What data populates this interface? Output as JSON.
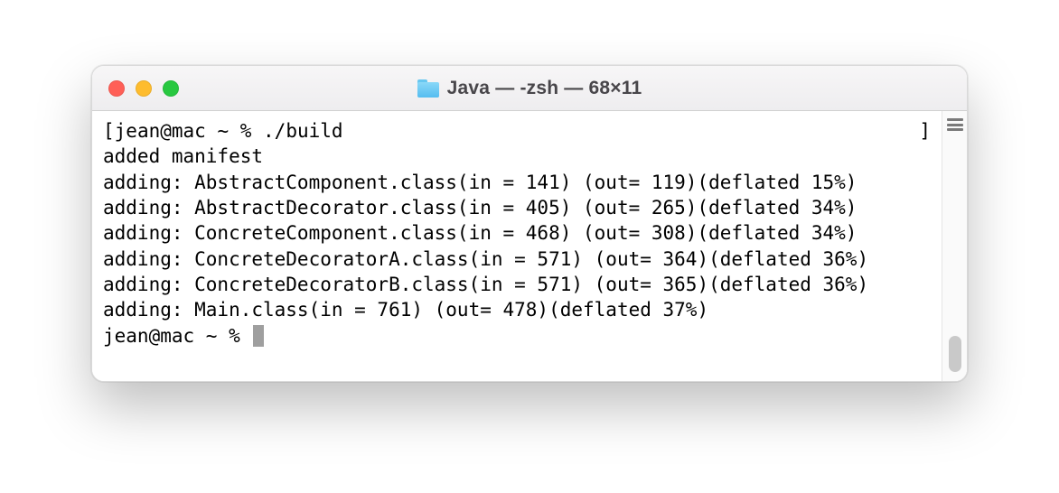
{
  "window": {
    "title": "Java — -zsh — 68×11",
    "folder_icon": "folder-icon"
  },
  "traffic": {
    "close": "close",
    "minimize": "minimize",
    "zoom": "zoom"
  },
  "terminal": {
    "prompt1_open": "[",
    "prompt1_user": "jean@mac ~ % ",
    "command1": "./build",
    "prompt1_close": "]",
    "lines": [
      "added manifest",
      "adding: AbstractComponent.class(in = 141) (out= 119)(deflated 15%)",
      "adding: AbstractDecorator.class(in = 405) (out= 265)(deflated 34%)",
      "adding: ConcreteComponent.class(in = 468) (out= 308)(deflated 34%)",
      "adding: ConcreteDecoratorA.class(in = 571) (out= 364)(deflated 36%)",
      "adding: ConcreteDecoratorB.class(in = 571) (out= 365)(deflated 36%)",
      "adding: Main.class(in = 761) (out= 478)(deflated 37%)"
    ],
    "prompt2": "jean@mac ~ % "
  }
}
